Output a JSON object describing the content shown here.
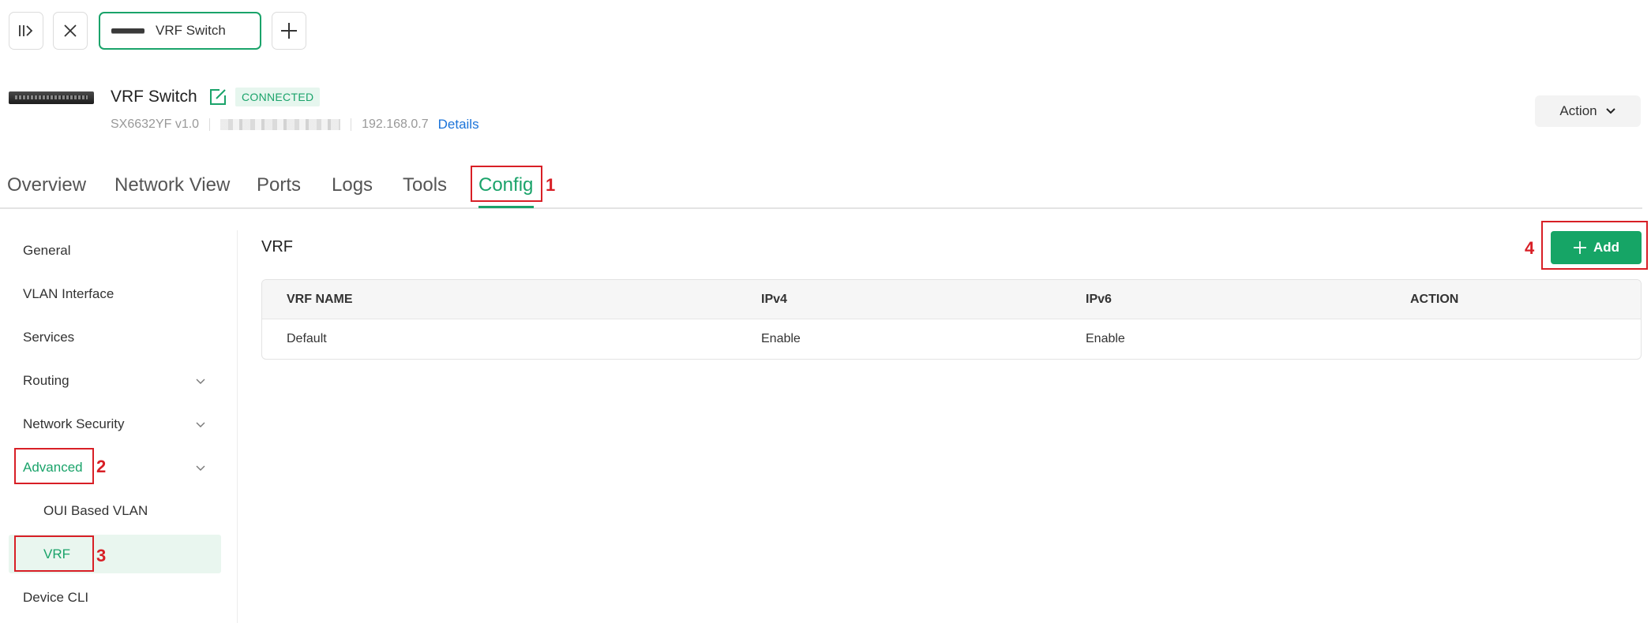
{
  "tab_strip": {
    "device_tab_label": "VRF Switch",
    "icons": [
      "sidebar-toggle-icon",
      "close-icon",
      "plus-icon"
    ]
  },
  "device": {
    "name": "VRF Switch",
    "status": "CONNECTED",
    "model": "SX6632YF v1.0",
    "ip": "192.168.0.7",
    "details_label": "Details",
    "action_label": "Action"
  },
  "main_tabs": [
    {
      "label": "Overview"
    },
    {
      "label": "Network View"
    },
    {
      "label": "Ports"
    },
    {
      "label": "Logs"
    },
    {
      "label": "Tools"
    },
    {
      "label": "Config",
      "active": true
    }
  ],
  "sidebar": {
    "items": [
      {
        "label": "General"
      },
      {
        "label": "VLAN Interface"
      },
      {
        "label": "Services"
      },
      {
        "label": "Routing",
        "expandable": true
      },
      {
        "label": "Network Security",
        "expandable": true
      },
      {
        "label": "Advanced",
        "expandable": true,
        "expanded": true
      },
      {
        "label": "OUI Based VLAN",
        "sub": true
      },
      {
        "label": "VRF",
        "sub": true,
        "active": true
      },
      {
        "label": "Device CLI"
      }
    ]
  },
  "content": {
    "title": "VRF",
    "add_label": "Add",
    "table": {
      "headers": [
        "VRF NAME",
        "IPv4",
        "IPv6",
        "ACTION"
      ],
      "rows": [
        [
          "Default",
          "Enable",
          "Enable",
          ""
        ]
      ]
    }
  },
  "annotations": [
    "1",
    "2",
    "3",
    "4"
  ],
  "colors": {
    "accent": "#1aa36a",
    "annotation": "#d81f26",
    "link": "#1a73d9"
  }
}
